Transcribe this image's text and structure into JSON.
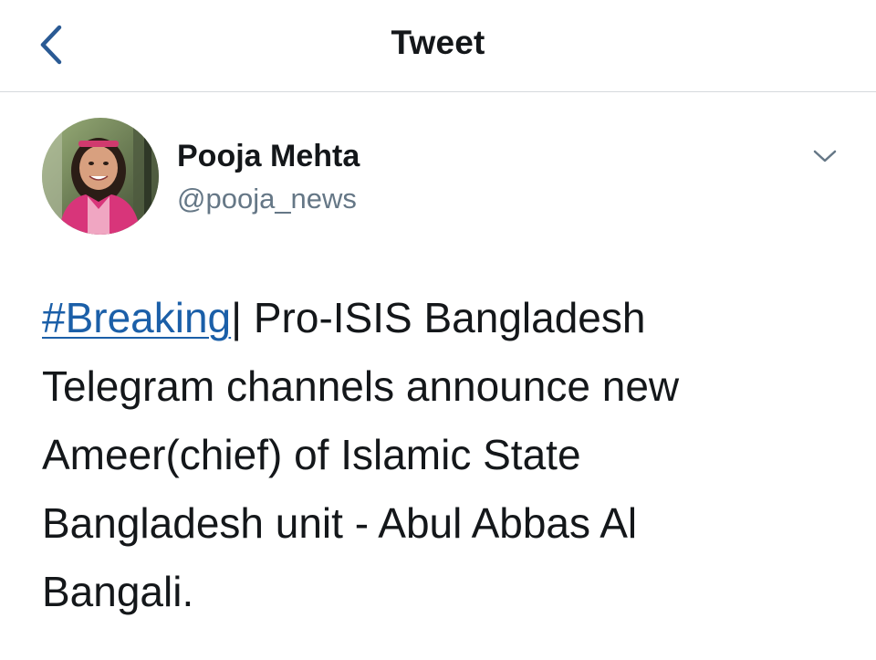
{
  "nav": {
    "title": "Tweet",
    "back_icon": "chevron-left-icon"
  },
  "tweet": {
    "author": {
      "name": "Pooja Mehta",
      "handle": "@pooja_news",
      "avatar": "profile-photo"
    },
    "more_icon": "chevron-down-icon",
    "hashtag": "#Breaking",
    "lines": [
      "| Pro-ISIS Bangladesh",
      "Telegram channels announce new",
      "Ameer(chief) of Islamic State",
      "Bangladesh unit - Abul Abbas Al",
      "Bangali."
    ]
  },
  "colors": {
    "link": "#1b5fa8",
    "text": "#14171a",
    "secondary_text": "#657786",
    "divider": "#d5d9dd",
    "back_chevron": "#2a5a94"
  }
}
